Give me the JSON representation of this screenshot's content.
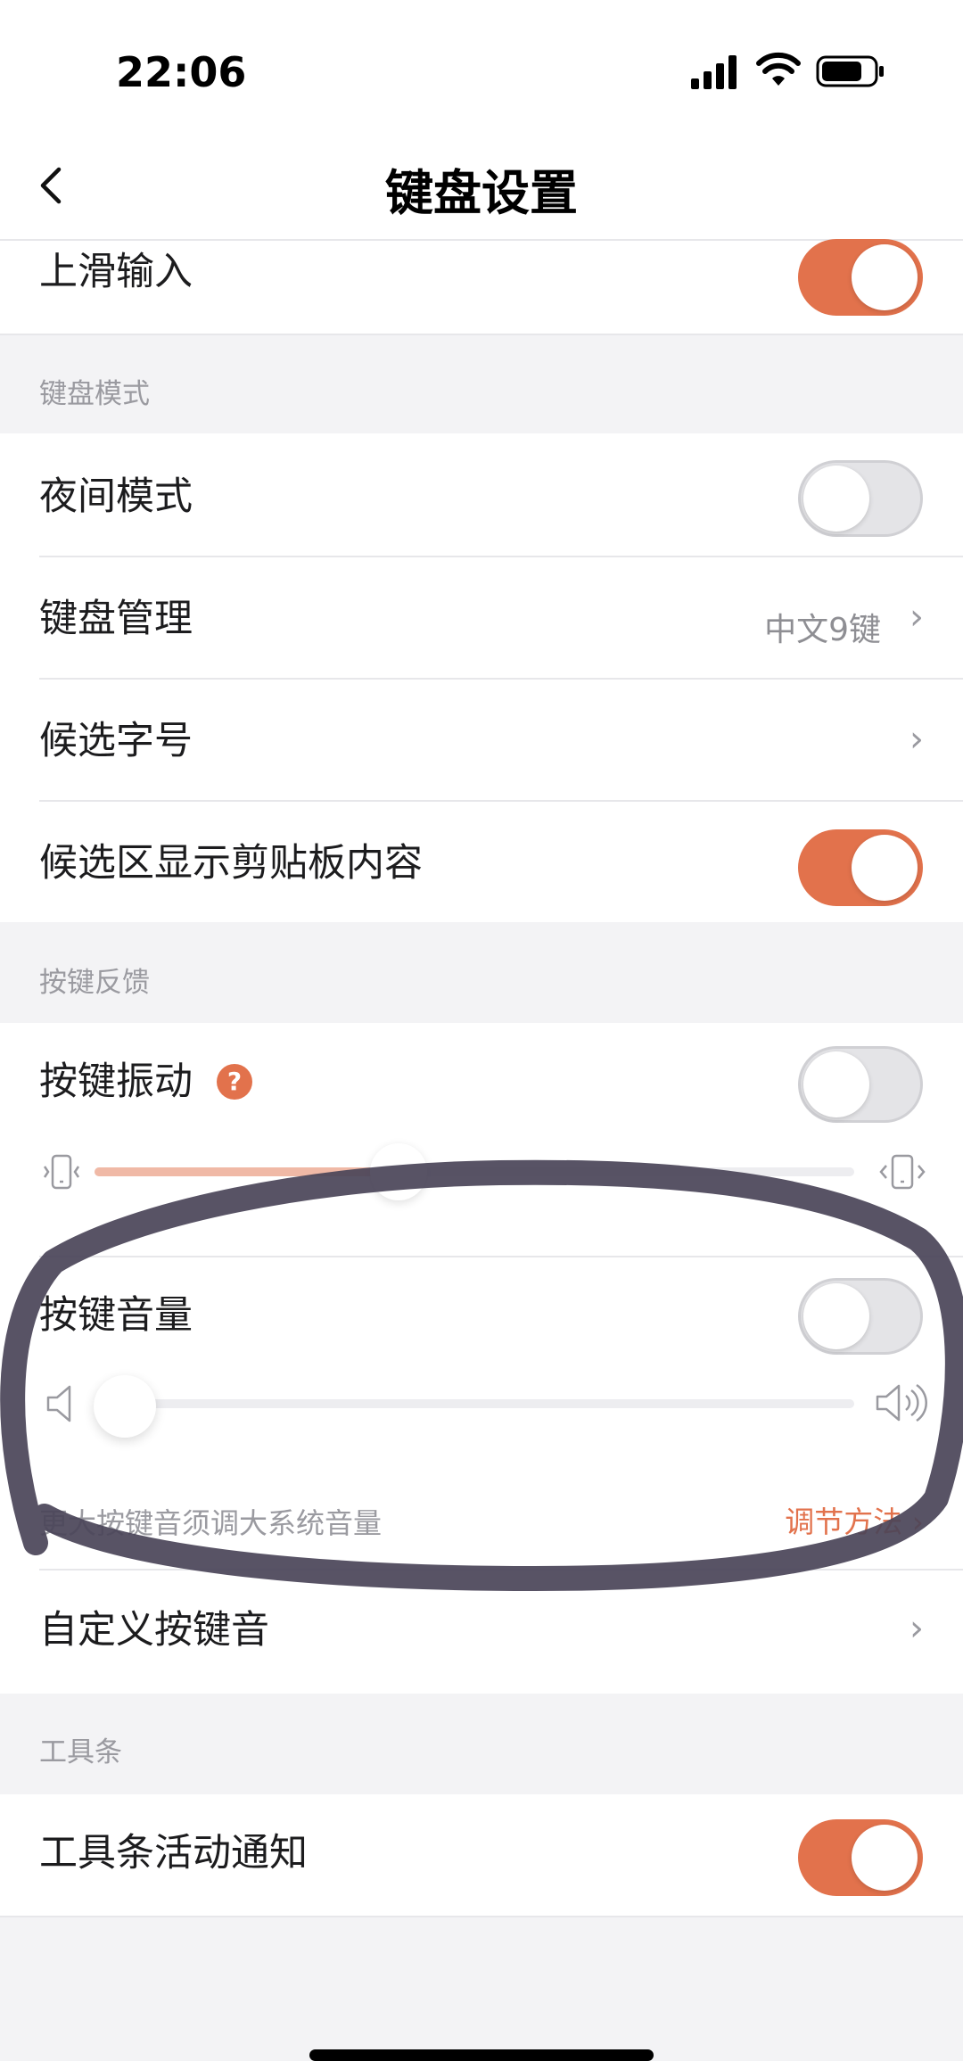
{
  "status_bar": {
    "time": "22:06"
  },
  "header": {
    "title": "键盘设置"
  },
  "rows": {
    "swipe_input": {
      "label": "上滑输入",
      "enabled": true
    },
    "night_mode": {
      "label": "夜间模式",
      "enabled": false
    },
    "keyboard_manage": {
      "label": "键盘管理",
      "value": "中文9键"
    },
    "candidate_font": {
      "label": "候选字号"
    },
    "clipboard_candidates": {
      "label": "候选区显示剪贴板内容",
      "enabled": true
    },
    "key_vibration": {
      "label": "按键振动",
      "help": "?",
      "enabled": false,
      "level": 0.4
    },
    "key_volume": {
      "label": "按键音量",
      "enabled": false,
      "level": 0.0
    },
    "volume_note": {
      "text": "更大按键音须调大系统音量",
      "link": "调节方法"
    },
    "custom_sound": {
      "label": "自定义按键音"
    },
    "toolbar_notify": {
      "label": "工具条活动通知",
      "enabled": true
    }
  },
  "sections": {
    "keyboard_mode": "键盘模式",
    "key_feedback": "按键反馈",
    "toolbar": "工具条"
  },
  "colors": {
    "accent": "#e2724c",
    "annotation": "#4a4458"
  }
}
